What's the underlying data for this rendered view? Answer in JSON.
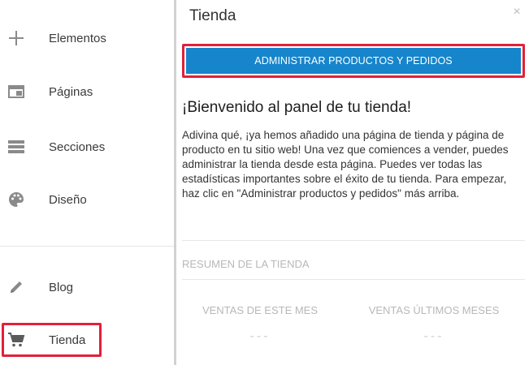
{
  "sidebar": {
    "items": [
      {
        "label": "Elementos",
        "icon": "plus-icon"
      },
      {
        "label": "Páginas",
        "icon": "pages-icon"
      },
      {
        "label": "Secciones",
        "icon": "sections-icon"
      },
      {
        "label": "Diseño",
        "icon": "palette-icon"
      },
      {
        "label": "Blog",
        "icon": "pencil-icon"
      },
      {
        "label": "Tienda",
        "icon": "cart-icon"
      }
    ]
  },
  "panel": {
    "title": "Tienda",
    "close_glyph": "×",
    "primary_button": "ADMINISTRAR PRODUCTOS Y PEDIDOS",
    "welcome_title": "¡Bienvenido al panel de tu tienda!",
    "welcome_text": "Adivina qué, ¡ya hemos añadido una página de tienda y página de producto en tu sitio web! Una vez que comiences a vender, puedes administrar la tienda desde esta página. Puedes ver todas las estadísticas importantes sobre el éxito de tu tienda. Para empezar, haz clic en \"Administrar productos y pedidos\" más arriba.",
    "summary_label": "RESUMEN DE LA TIENDA",
    "stats": [
      {
        "title": "VENTAS DE ESTE MES",
        "value": "---"
      },
      {
        "title": "VENTAS ÚLTIMOS MESES",
        "value": "---"
      }
    ]
  },
  "colors": {
    "accent": "#1685cb",
    "highlight": "#e2203a"
  }
}
